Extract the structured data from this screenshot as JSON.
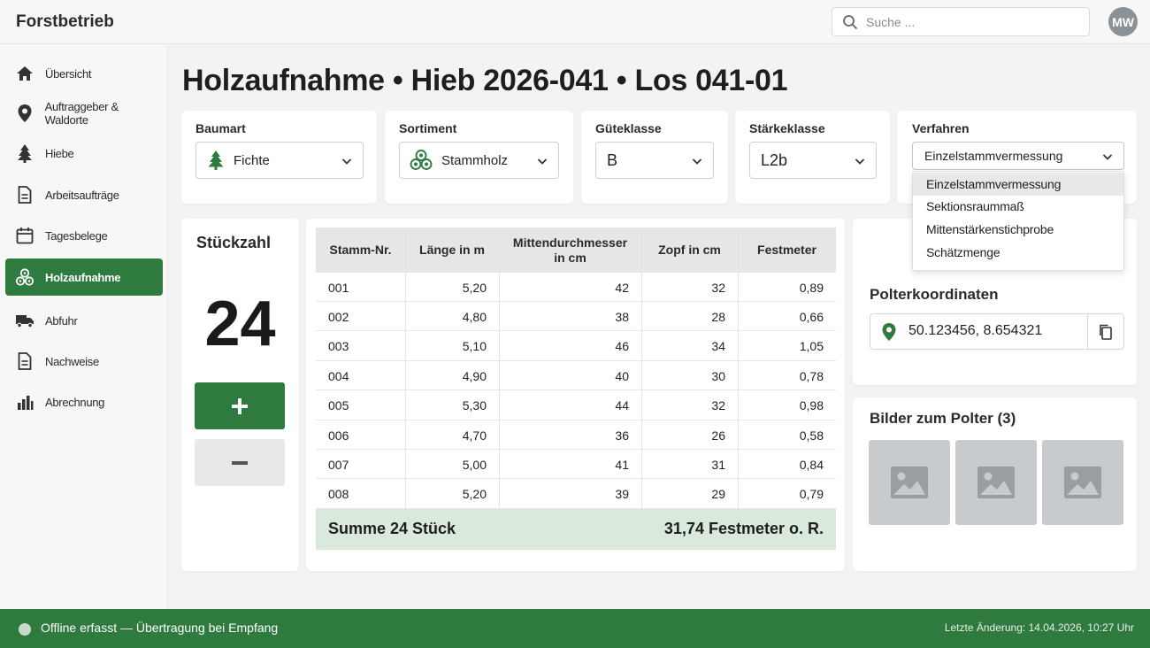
{
  "app": {
    "brand": "Forstbetrieb",
    "avatar_initials": "MW"
  },
  "search": {
    "placeholder": "Suche ...",
    "icon": "search-icon"
  },
  "sidebar": {
    "items": [
      {
        "label": "Übersicht",
        "icon": "home-icon",
        "active": false
      },
      {
        "label": "Auftraggeber & Waldorte",
        "icon": "map-pin-icon",
        "active": false
      },
      {
        "label": "Hiebe",
        "icon": "tree-icon",
        "active": false
      },
      {
        "label": "Arbeitsaufträge",
        "icon": "document-icon",
        "active": false
      },
      {
        "label": "Tagesbelege",
        "icon": "calendar-icon",
        "active": false
      },
      {
        "label": "Holzaufnahme",
        "icon": "log-pile-icon",
        "active": true
      },
      {
        "label": "Abfuhr",
        "icon": "truck-icon",
        "active": false
      },
      {
        "label": "Nachweise",
        "icon": "document-icon",
        "active": false
      },
      {
        "label": "Abrechnung",
        "icon": "bar-chart-icon",
        "active": false
      }
    ]
  },
  "page": {
    "title": "Holzaufnahme • Hieb 2026-041 • Los 041-01"
  },
  "filters": {
    "baumart": {
      "label": "Baumart",
      "value": "Fichte",
      "icon": "spruce-tree-icon"
    },
    "sortiment": {
      "label": "Sortiment",
      "value": "Stammholz",
      "icon": "log-pile-icon"
    },
    "gueteklasse": {
      "label": "Güteklasse",
      "value": "B"
    },
    "staerkeklasse": {
      "label": "Stärkeklasse",
      "value": "L2b"
    },
    "verfahren": {
      "label": "Verfahren",
      "value": "Einzelstammvermessung",
      "options": [
        "Einzelstammvermessung",
        "Sektionsraummaß",
        "Mittenstärkenstichprobe",
        "Schätzmenge"
      ],
      "selected_index": 0
    }
  },
  "counter": {
    "title": "Stückzahl",
    "value": "24",
    "plus_icon": "plus-icon",
    "minus_icon": "minus-icon"
  },
  "table": {
    "headers": [
      "Stamm-Nr.",
      "Länge in m",
      "Mittendurchmesser in cm",
      "Zopf in cm",
      "Festmeter"
    ],
    "rows": [
      [
        "001",
        "5,20",
        "42",
        "32",
        "0,89"
      ],
      [
        "002",
        "4,80",
        "38",
        "28",
        "0,66"
      ],
      [
        "003",
        "5,10",
        "46",
        "34",
        "1,05"
      ],
      [
        "004",
        "4,90",
        "40",
        "30",
        "0,78"
      ],
      [
        "005",
        "5,30",
        "44",
        "32",
        "0,98"
      ],
      [
        "006",
        "4,70",
        "36",
        "26",
        "0,58"
      ],
      [
        "007",
        "5,00",
        "41",
        "31",
        "0,84"
      ],
      [
        "008",
        "5,20",
        "39",
        "29",
        "0,79"
      ]
    ],
    "summary_left": "Summe  24 Stück",
    "summary_right": "31,74 Festmeter o. R."
  },
  "coordinates": {
    "title": "Polterkoordinaten",
    "value": "50.123456, 8.654321",
    "pin_icon": "map-pin-icon",
    "copy_icon": "copy-icon"
  },
  "images": {
    "title": "Bilder zum Polter (3)",
    "thumb_icon": "image-placeholder-icon"
  },
  "statusbar": {
    "left": "Offline erfasst — Übertragung bei Empfang",
    "right": "Letzte Änderung: 14.04.2026, 10:27 Uhr"
  },
  "colors": {
    "accent": "#2f7a3f",
    "summary_bg": "#d9eadc",
    "header_bg": "#e4e7e5",
    "page_bg": "#f2f3f3"
  }
}
